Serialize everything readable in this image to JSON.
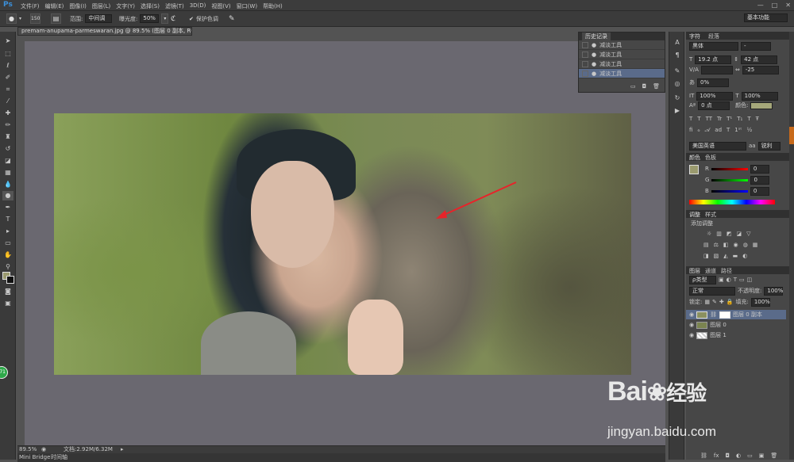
{
  "app": {
    "logo": "Ps"
  },
  "menu": [
    "文件(F)",
    "编辑(E)",
    "图像(I)",
    "图层(L)",
    "文字(Y)",
    "选择(S)",
    "滤镜(T)",
    "3D(D)",
    "视图(V)",
    "窗口(W)",
    "帮助(H)"
  ],
  "window_controls": [
    "—",
    "□",
    "✕"
  ],
  "options": {
    "brush_size": "150",
    "range_label": "范围:",
    "range_value": "中间调",
    "exposure_label": "曝光度:",
    "exposure_value": "50%",
    "protect_tones": "保护色调",
    "workspace": "基本功能"
  },
  "document": {
    "tab": "premam-anupama-parmeswaran.jpg @ 89.5% (图层 0 副本, RGB/8) *",
    "zoom": "89.5%",
    "doc_size": "文档:2.92M/6.32M"
  },
  "bottom_tabs": [
    "Mini Bridge",
    "时间轴"
  ],
  "history": {
    "title": "历史记录",
    "items": [
      "减淡工具",
      "减淡工具",
      "减淡工具",
      "减淡工具"
    ],
    "selected_index": 3
  },
  "character": {
    "tab1": "字符",
    "tab2": "段落",
    "font_family": "黑体",
    "font_style": "-",
    "font_size": "19.2 点",
    "leading": "42 点",
    "kerning": "",
    "tracking": "-25",
    "tsume": "0%",
    "vscale": "100%",
    "hscale": "100%",
    "baseline": "0 点",
    "color_label": "颜色:",
    "style_buttons": [
      "T",
      "T",
      "TT",
      "Tr",
      "T¹",
      "T₁",
      "T",
      "Ŧ"
    ],
    "lang": "美国英语",
    "aa": "锐利",
    "aa_prefix": "aa"
  },
  "color": {
    "tab1": "颜色",
    "tab2": "色板",
    "channels": [
      {
        "name": "R",
        "value": "0"
      },
      {
        "name": "G",
        "value": "0"
      },
      {
        "name": "B",
        "value": "0"
      }
    ],
    "swatch": "#9a9a6e"
  },
  "adjust": {
    "tab1": "调整",
    "tab2": "样式",
    "title": "添加调整"
  },
  "layers": {
    "tabs": [
      "图层",
      "通道",
      "路径"
    ],
    "kind": "ρ类型",
    "blend": "正常",
    "opacity_label": "不透明度:",
    "opacity": "100%",
    "lock_label": "锁定:",
    "fill_label": "填充:",
    "fill": "100%",
    "items": [
      {
        "name": "图层 0 副本",
        "selected": true
      },
      {
        "name": "图层 0",
        "selected": false
      },
      {
        "name": "图层 1",
        "selected": false
      }
    ]
  },
  "watermark": {
    "brand": "Bai",
    "brand2": "经验",
    "url": "jingyan.baidu.com"
  },
  "green_badge": "71"
}
